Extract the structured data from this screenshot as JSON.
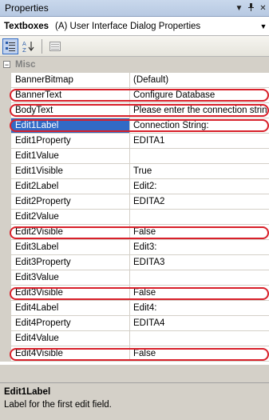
{
  "window": {
    "title": "Properties"
  },
  "object_selector": {
    "name": "Textboxes",
    "type": "(A)  User Interface Dialog Properties"
  },
  "toolbar": {
    "categorized_tip": "Categorized",
    "alphabetical_tip": "Alphabetical",
    "pages_tip": "Property Pages"
  },
  "grid": {
    "category": {
      "expander": "⊟",
      "label": "Misc"
    },
    "rows": [
      {
        "name": "BannerBitmap",
        "value": "(Default)"
      },
      {
        "name": "BannerText",
        "value": "Configure Database"
      },
      {
        "name": "BodyText",
        "value": "Please enter the connection strin"
      },
      {
        "name": "Edit1Label",
        "value": "Connection String:"
      },
      {
        "name": "Edit1Property",
        "value": "EDITA1"
      },
      {
        "name": "Edit1Value",
        "value": ""
      },
      {
        "name": "Edit1Visible",
        "value": "True"
      },
      {
        "name": "Edit2Label",
        "value": "Edit2:"
      },
      {
        "name": "Edit2Property",
        "value": "EDITA2"
      },
      {
        "name": "Edit2Value",
        "value": ""
      },
      {
        "name": "Edit2Visible",
        "value": "False"
      },
      {
        "name": "Edit3Label",
        "value": "Edit3:"
      },
      {
        "name": "Edit3Property",
        "value": "EDITA3"
      },
      {
        "name": "Edit3Value",
        "value": ""
      },
      {
        "name": "Edit3Visible",
        "value": "False"
      },
      {
        "name": "Edit4Label",
        "value": "Edit4:"
      },
      {
        "name": "Edit4Property",
        "value": "EDITA4"
      },
      {
        "name": "Edit4Value",
        "value": ""
      },
      {
        "name": "Edit4Visible",
        "value": "False"
      }
    ]
  },
  "description": {
    "title": "Edit1Label",
    "text": "Label for the first edit field."
  },
  "colors": {
    "selection": "#316ac5",
    "highlight_annotation": "#d8202a"
  }
}
